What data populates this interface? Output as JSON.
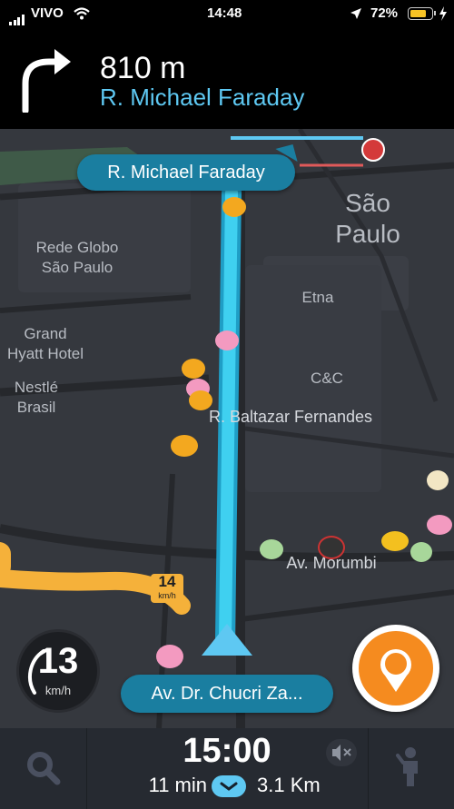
{
  "status_bar": {
    "carrier": "VIVO",
    "time": "14:48",
    "battery": "72%"
  },
  "navigation": {
    "distance": "810 m",
    "street": "R. Michael Faraday"
  },
  "map": {
    "next_street_callout": "R. Michael Faraday",
    "current_street_callout": "Av. Dr. Chucri Za...",
    "labels": {
      "city": "São\nPaulo",
      "rede_globo": "Rede Globo\nSão Paulo",
      "etna": "Etna",
      "grand_hyatt": "Grand\nHyatt Hotel",
      "nestle": "Nestlé\nBrasil",
      "cc": "C&C",
      "baltazar": "R. Baltazar Fernandes",
      "morumbi": "Av. Morumbi"
    },
    "traffic_speed": {
      "value": "14",
      "unit": "km/h"
    }
  },
  "speedometer": {
    "value": "13",
    "unit": "km/h"
  },
  "bottom_bar": {
    "eta_time": "15:00",
    "duration": "11 min",
    "distance": "3.1 Km"
  },
  "colors": {
    "route": "#3fd0f0",
    "callout": "#1a7ea0",
    "traffic": "#f5b13a",
    "report": "#f58b1f",
    "accent_text": "#5ec8f2"
  },
  "icons": [
    "turn-right-arrow-icon",
    "search-icon",
    "mute-icon",
    "person-icon",
    "waze-report-icon",
    "wifi-icon",
    "location-arrow-icon",
    "battery-icon"
  ]
}
